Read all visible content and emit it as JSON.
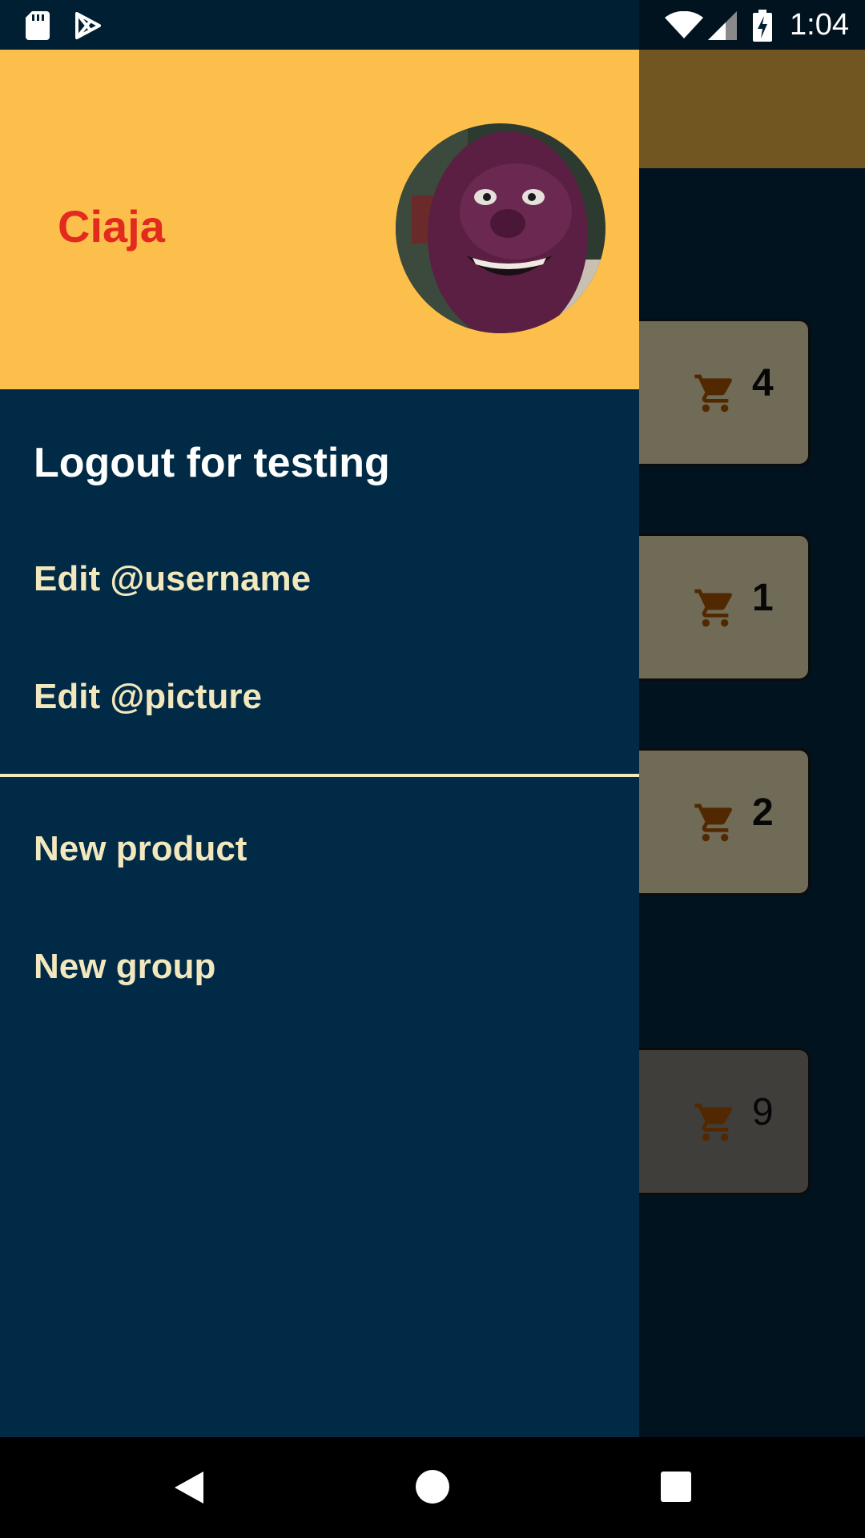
{
  "status_bar": {
    "time": "1:04",
    "left_icons": [
      "sd-card-icon",
      "play-store-icon"
    ],
    "right_icons": [
      "wifi-icon",
      "signal-icon",
      "battery-charging-icon"
    ]
  },
  "drawer": {
    "header": {
      "user_name": "Ciaja",
      "avatar": "avatar-photo"
    },
    "items": [
      {
        "label": "Logout for testing"
      },
      {
        "label": "Edit @username"
      },
      {
        "label": "Edit @picture"
      },
      {
        "label": "New product"
      },
      {
        "label": "New group"
      }
    ]
  },
  "background_cards": [
    {
      "icon": "cart-icon",
      "count": "4"
    },
    {
      "icon": "cart-icon",
      "count": "1"
    },
    {
      "icon": "cart-icon",
      "count": "2"
    },
    {
      "icon": "cart-icon",
      "count": "9"
    }
  ],
  "colors": {
    "header": "#fdbf4b",
    "drawer": "#002a45",
    "name": "#e32a1e",
    "menu_text": "#f2e7bd",
    "cart": "#b55a00"
  },
  "nav_bar": {
    "buttons": [
      "back-icon",
      "home-icon",
      "recents-icon"
    ]
  }
}
